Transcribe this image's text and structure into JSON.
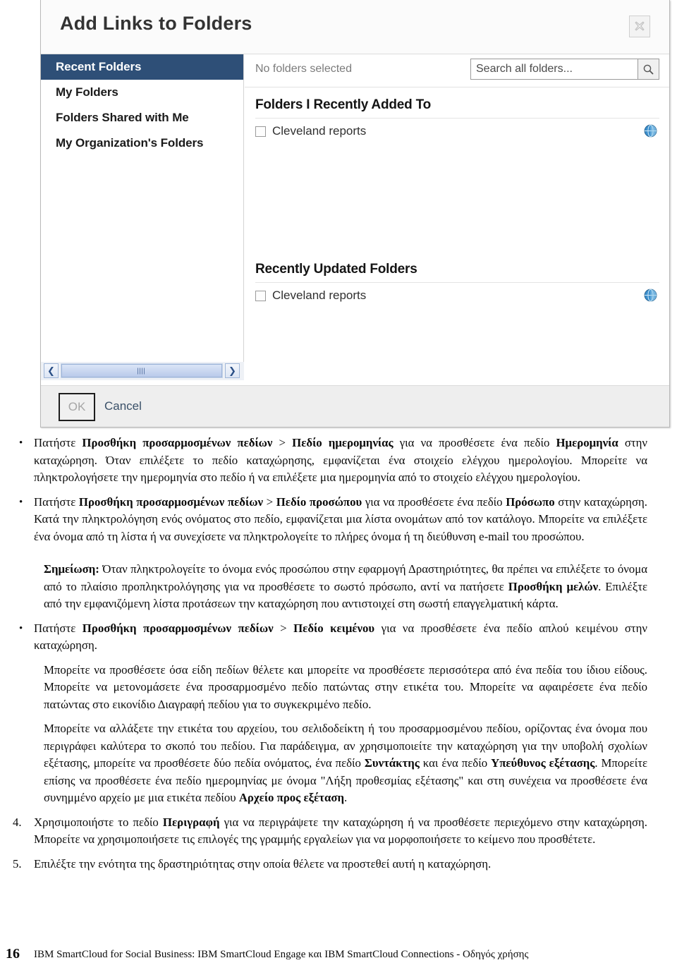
{
  "dialog": {
    "title": "Add Links to Folders",
    "close_label": "Close",
    "nav": {
      "items": [
        {
          "label": "Recent Folders",
          "selected": true
        },
        {
          "label": "My Folders",
          "selected": false
        },
        {
          "label": "Folders Shared with Me",
          "selected": false
        },
        {
          "label": "My Organization's Folders",
          "selected": false
        }
      ]
    },
    "selection_status": "No folders selected",
    "search": {
      "value": "",
      "placeholder": "Search all folders..."
    },
    "sections": [
      {
        "title": "Folders I Recently Added To",
        "rows": [
          {
            "name": "Cleveland reports",
            "checked": false
          }
        ]
      },
      {
        "title": "Recently Updated Folders",
        "rows": [
          {
            "name": "Cleveland reports",
            "checked": false
          }
        ]
      }
    ],
    "footer": {
      "ok_label": "OK",
      "cancel_label": "Cancel"
    },
    "colors": {
      "nav_selected_bg": "#2e4f77",
      "footer_bg": "#eeeeee",
      "globe": "#3d8fcc"
    }
  },
  "doc": {
    "b1": {
      "p1_a": "Πατήστε ",
      "p1_b1": "Προσθήκη προσαρμοσμένων πεδίων",
      "p1_sep": " > ",
      "p1_b2": "Πεδίο ημερομηνίας",
      "p1_c": " για να προσθέσετε ένα πεδίο ",
      "p1_b3": "Ημερομηνία",
      "p1_d": " στην καταχώρηση. Όταν επιλέξετε το πεδίο καταχώρησης, εμφανίζεται ένα στοιχείο ελέγχου ημερολογίου. Μπορείτε να πληκτρολογήσετε την ημερομηνία στο πεδίο ή να επιλέξετε μια ημερομηνία από το στοιχείο ελέγχου ημερολογίου."
    },
    "b2": {
      "p_a": "Πατήστε ",
      "p_b1": "Προσθήκη προσαρμοσμένων πεδίων",
      "p_sep": " > ",
      "p_b2": "Πεδίο προσώπου",
      "p_c": " για να προσθέσετε ένα πεδίο ",
      "p_b3": "Πρόσωπο",
      "p_d": " στην καταχώρηση. Κατά την πληκτρολόγηση ενός ονόματος στο πεδίο, εμφανίζεται μια λίστα ονομάτων από τον κατάλογο. Μπορείτε να επιλέξετε ένα όνομα από τη λίστα ή να συνεχίσετε να πληκτρολογείτε το πλήρες όνομα ή τη διεύθυνση e-mail του προσώπου."
    },
    "note": {
      "label": "Σημείωση:",
      "text_a": "  Όταν πληκτρολογείτε το όνομα ενός προσώπου στην εφαρμογή Δραστηριότητες, θα πρέπει να επιλέξετε το όνομα από το πλαίσιο προπληκτρολόγησης για να προσθέσετε το σωστό πρόσωπο, αντί να πατήσετε ",
      "bold_b": "Προσθήκη μελών",
      "text_c": ". Επιλέξτε από την εμφανιζόμενη λίστα προτάσεων την καταχώρηση που αντιστοιχεί στη σωστή επαγγελματική κάρτα."
    },
    "b3": {
      "p_a": "Πατήστε ",
      "p_b1": "Προσθήκη προσαρμοσμένων πεδίων",
      "p_sep": " > ",
      "p_b2": "Πεδίο κειμένου",
      "p_c": " για να προσθέσετε ένα πεδίο απλού κειμένου στην καταχώρηση."
    },
    "p_fields": "Μπορείτε να προσθέσετε όσα είδη πεδίων θέλετε και μπορείτε να προσθέσετε περισσότερα από ένα πεδία του ίδιου είδους. Μπορείτε να μετονομάσετε ένα προσαρμοσμένο πεδίο πατώντας στην ετικέτα του. Μπορείτε να αφαιρέσετε ένα πεδίο πατώντας στο εικονίδιο Διαγραφή πεδίου για το συγκεκριμένο πεδίο.",
    "p_rename": {
      "a": "Μπορείτε να αλλάξετε την ετικέτα του αρχείου, του σελιδοδείκτη ή του προσαρμοσμένου πεδίου, ορίζοντας ένα όνομα που περιγράφει καλύτερα το σκοπό του πεδίου. Για παράδειγμα, αν χρησιμοποιείτε την καταχώρηση για την υποβολή σχολίων εξέτασης, μπορείτε να προσθέσετε δύο πεδία ονόματος, ένα πεδίο ",
      "b1": "Συντάκτης",
      "c": " και ένα πεδίο ",
      "b2": "Υπεύθυνος εξέτασης",
      "d": ". Μπορείτε επίσης να προσθέσετε ένα πεδίο ημερομηνίας με όνομα \"Λήξη προθεσμίας εξέτασης\" και στη συνέχεια να προσθέσετε ένα συνημμένο αρχείο με μια ετικέτα πεδίου ",
      "b3": "Αρχείο προς εξέταση",
      "e": "."
    },
    "step4": {
      "num": "4.",
      "a": "Χρησιμοποιήστε το πεδίο ",
      "b": "Περιγραφή",
      "c": " για να περιγράψετε την καταχώρηση ή να προσθέσετε περιεχόμενο στην καταχώρηση. Μπορείτε να χρησιμοποιήσετε τις επιλογές της γραμμής εργαλείων για να μορφοποιήσετε το κείμενο που προσθέτετε."
    },
    "step5": {
      "num": "5.",
      "a": "Επιλέξτε την ενότητα της δραστηριότητας στην οποία θέλετε να προστεθεί αυτή η καταχώρηση."
    }
  },
  "page_footer": {
    "page_number": "16",
    "text": "IBM SmartCloud for Social Business: IBM SmartCloud Engage και IBM SmartCloud Connections - Οδηγός χρήσης"
  }
}
